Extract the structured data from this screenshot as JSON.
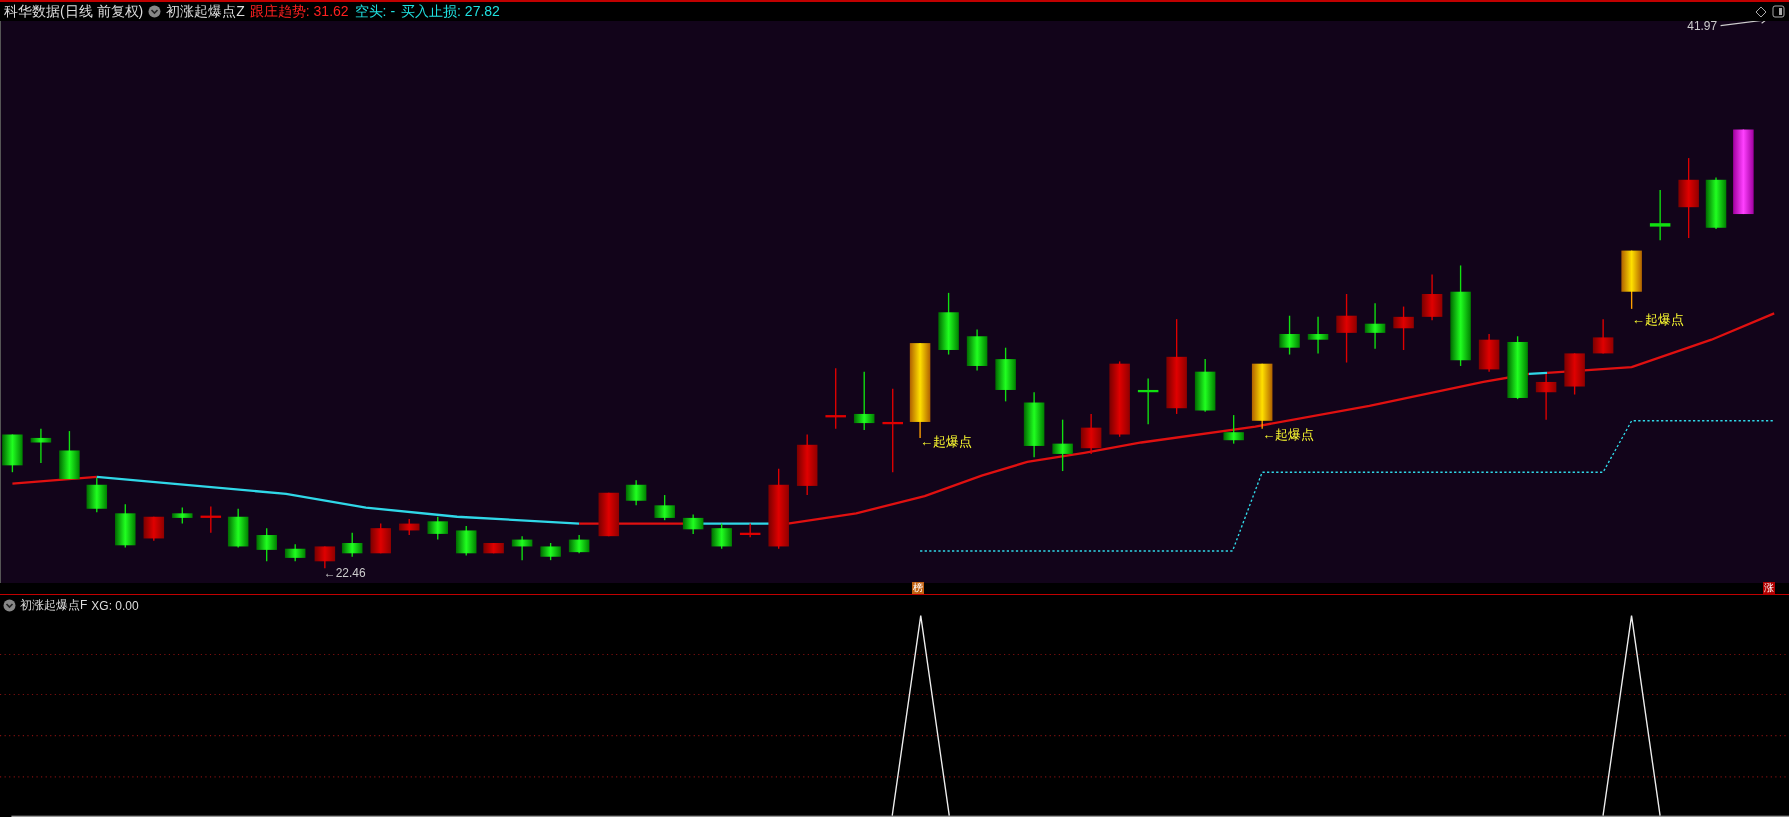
{
  "header": {
    "title": "科华数据(日线 前复权)",
    "indicator": "初涨起爆点Z",
    "values": [
      {
        "label": "跟庄趋势: 31.62",
        "color": "#ff2020"
      },
      {
        "label": "空头: -",
        "color": "#20e0e0"
      },
      {
        "label": "买入止损: 27.82",
        "color": "#20e0e0"
      }
    ]
  },
  "main_chart": {
    "price_labels": [
      {
        "text": "41.97"
      },
      {
        "text": "←22.46"
      }
    ],
    "signals": [
      {
        "text": "←起爆点"
      },
      {
        "text": "←起爆点"
      },
      {
        "text": "←起爆点"
      }
    ]
  },
  "markers": [
    {
      "text": "榜",
      "color": "#c06010"
    },
    {
      "text": "涨",
      "color": "#b00000"
    }
  ],
  "sub_panel": {
    "indicator": "初涨起爆点F",
    "reading": "XG: 0.00"
  }
}
